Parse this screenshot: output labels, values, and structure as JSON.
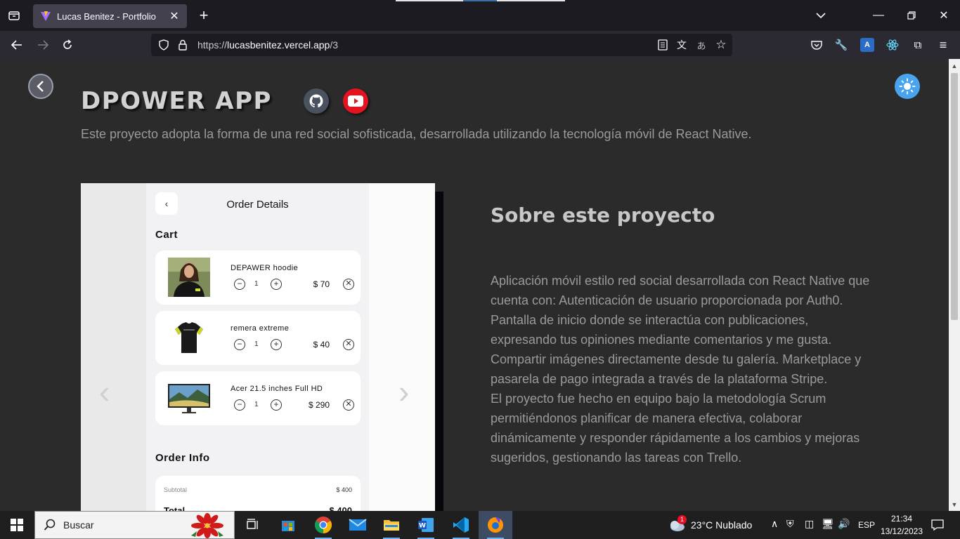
{
  "browser": {
    "tab_title": "Lucas Benitez - Portfolio",
    "url_base": "https://",
    "url_host": "lucasbenitez.vercel.app",
    "url_path": "/3"
  },
  "page": {
    "project_title": "DPOWER APP",
    "project_desc": "Este proyecto adopta la forma de una red social sofisticada, desarrollada utilizando la tecnología móvil de React Native.",
    "about_heading": "Sobre este proyecto",
    "about_text_1": "Aplicación móvil estilo red social desarrollada con React Native que cuenta con: Autenticación de usuario proporcionada por Auth0. Pantalla de inicio donde se interactúa con publicaciones, expresando tus opiniones mediante comentarios y me gusta. Compartir imágenes directamente desde tu galería. Marketplace y pasarela de pago integrada a través de la plataforma Stripe.",
    "about_text_2": "El proyecto fue hecho en equipo bajo la metodología Scrum permitiéndonos planificar de manera efectiva, colaborar dinámicamente y responder rápidamente a los cambios y mejoras sugeridos, gestionando las tareas con Trello."
  },
  "phone": {
    "screen_title": "Order Details",
    "cart_heading": "Cart",
    "items": [
      {
        "name": "DEPAWER hoodie",
        "qty": "1",
        "price": "$ 70"
      },
      {
        "name": "remera extreme",
        "qty": "1",
        "price": "$ 40"
      },
      {
        "name": "Acer 21.5 inches Full HD",
        "qty": "1",
        "price": "$ 290"
      }
    ],
    "order_heading": "Order Info",
    "subtotal_label": "Subtotal",
    "subtotal_value": "$ 400",
    "total_label": "Total",
    "total_value": "$ 400"
  },
  "taskbar": {
    "search_label": "Buscar",
    "weather_badge": "1",
    "weather": "23°C  Nublado",
    "lang": "ESP",
    "time": "21:34",
    "date": "13/12/2023"
  },
  "colors": {
    "accent": "#4aa3ee",
    "youtube": "#e3141f",
    "page_bg": "#2b2b2b"
  }
}
